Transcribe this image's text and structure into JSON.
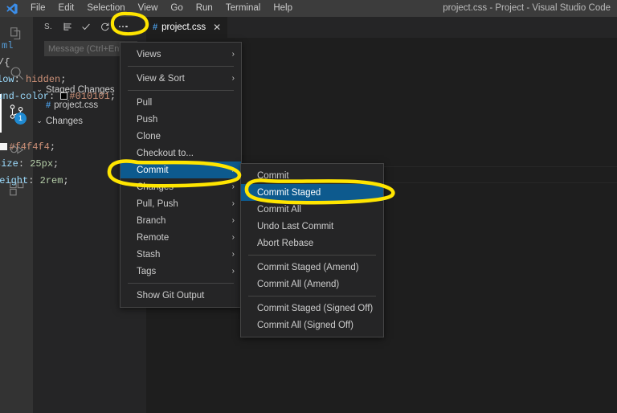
{
  "window": {
    "title": "project.css - Project - Visual Studio Code",
    "logo_icon": "vscode-logo-icon"
  },
  "menubar": {
    "items": [
      {
        "label": "File",
        "name": "menubar-item-file"
      },
      {
        "label": "Edit",
        "name": "menubar-item-edit"
      },
      {
        "label": "Selection",
        "name": "menubar-item-selection"
      },
      {
        "label": "View",
        "name": "menubar-item-view"
      },
      {
        "label": "Go",
        "name": "menubar-item-go"
      },
      {
        "label": "Run",
        "name": "menubar-item-run"
      },
      {
        "label": "Terminal",
        "name": "menubar-item-terminal"
      },
      {
        "label": "Help",
        "name": "menubar-item-help"
      }
    ]
  },
  "activity_bar": {
    "items": [
      {
        "icon": "files-explorer-icon",
        "active": false,
        "badge": ""
      },
      {
        "icon": "search-icon",
        "active": false,
        "badge": ""
      },
      {
        "icon": "source-control-icon",
        "active": true,
        "badge": "1"
      },
      {
        "icon": "run-and-debug-icon",
        "active": false,
        "badge": ""
      },
      {
        "icon": "extensions-icon",
        "active": false,
        "badge": ""
      }
    ],
    "badge_color": "#1f8ad2"
  },
  "sidebar": {
    "view_title": "S.",
    "toolbar": [
      {
        "icon": "view-as-list-icon",
        "title": "View as Tree/List"
      },
      {
        "icon": "checkmark-icon",
        "title": "Commit"
      },
      {
        "icon": "refresh-icon",
        "title": "Refresh"
      },
      {
        "icon": "more-actions-icon",
        "title": "More Actions..."
      }
    ],
    "commit_input": {
      "value": "",
      "placeholder": "Message (Ctrl+Ent"
    },
    "groups": [
      {
        "label": "Staged Changes",
        "expanded": true,
        "chevron": "⌄"
      },
      {
        "label": "Changes",
        "expanded": true,
        "chevron": "⌄"
      }
    ],
    "staged_files": [
      {
        "name": "project.css",
        "icon": "css-file-icon",
        "icon_glyph": "#"
      }
    ]
  },
  "editor": {
    "tab": {
      "label": "project.css",
      "icon_glyph": "#",
      "close_glyph": "✕"
    },
    "code_lines": [
      {
        "text": "ml",
        "type": "plain"
      },
      {
        "text": "/{",
        "type": "plain"
      },
      {
        "prop": "low",
        "value": "hidden",
        "type": "decl"
      },
      {
        "prop": "ound-color",
        "value": "#010101",
        "type": "decl-color",
        "swatch": "#010101"
      },
      {
        "text": "",
        "type": "plain"
      },
      {
        "text": "",
        "type": "plain"
      },
      {
        "prop": ";",
        "value": "#f4f4f4",
        "type": "decl-color2",
        "swatch": "#f4f4f4"
      },
      {
        "prop": "size",
        "value": "25px",
        "type": "decl-num"
      },
      {
        "prop": "height",
        "value": "2rem",
        "type": "decl-num"
      }
    ]
  },
  "context_menu": {
    "name": "scm-more-actions-menu",
    "items": [
      {
        "label": "Views",
        "submenu": true,
        "separator_after": true,
        "selected": false
      },
      {
        "label": "View & Sort",
        "submenu": true,
        "separator_after": true,
        "selected": false
      },
      {
        "label": "Pull",
        "submenu": false,
        "separator_after": false,
        "selected": false
      },
      {
        "label": "Push",
        "submenu": false,
        "separator_after": false,
        "selected": false
      },
      {
        "label": "Clone",
        "submenu": false,
        "separator_after": false,
        "selected": false
      },
      {
        "label": "Checkout to...",
        "submenu": false,
        "separator_after": false,
        "selected": false
      },
      {
        "label": "Commit",
        "submenu": true,
        "separator_after": false,
        "selected": true
      },
      {
        "label": "Changes",
        "submenu": true,
        "separator_after": false,
        "selected": false
      },
      {
        "label": "Pull, Push",
        "submenu": true,
        "separator_after": false,
        "selected": false
      },
      {
        "label": "Branch",
        "submenu": true,
        "separator_after": false,
        "selected": false
      },
      {
        "label": "Remote",
        "submenu": true,
        "separator_after": false,
        "selected": false
      },
      {
        "label": "Stash",
        "submenu": true,
        "separator_after": false,
        "selected": false
      },
      {
        "label": "Tags",
        "submenu": true,
        "separator_after": true,
        "selected": false
      },
      {
        "label": "Show Git Output",
        "submenu": false,
        "separator_after": false,
        "selected": false
      }
    ],
    "arrow_glyph": "›"
  },
  "submenu": {
    "name": "commit-submenu",
    "items": [
      {
        "label": "Commit",
        "separator_after": false,
        "selected": false
      },
      {
        "label": "Commit Staged",
        "separator_after": false,
        "selected": true
      },
      {
        "label": "Commit All",
        "separator_after": false,
        "selected": false
      },
      {
        "label": "Undo Last Commit",
        "separator_after": false,
        "selected": false
      },
      {
        "label": "Abort Rebase",
        "separator_after": true,
        "selected": false
      },
      {
        "label": "Commit Staged (Amend)",
        "separator_after": false,
        "selected": false
      },
      {
        "label": "Commit All (Amend)",
        "separator_after": true,
        "selected": false
      },
      {
        "label": "Commit Staged (Signed Off)",
        "separator_after": false,
        "selected": false
      },
      {
        "label": "Commit All (Signed Off)",
        "separator_after": false,
        "selected": false
      }
    ]
  },
  "annotations": {
    "color": "#ffe500",
    "marks": [
      {
        "name": "annotation-circle-more-actions",
        "target": "more-actions-icon"
      },
      {
        "name": "annotation-circle-commit",
        "target": "menu-item-commit"
      },
      {
        "name": "annotation-circle-commit-staged",
        "target": "submenu-item-commit-staged"
      }
    ]
  },
  "colors": {
    "titlebar_bg": "#3c3c3c",
    "activitybar_bg": "#333333",
    "sidebar_bg": "#252526",
    "editor_bg": "#1e1e1e",
    "menu_bg": "#252526",
    "menu_border": "#454545",
    "selection_bg": "#0d5a8e",
    "accent": "#ffe500"
  }
}
